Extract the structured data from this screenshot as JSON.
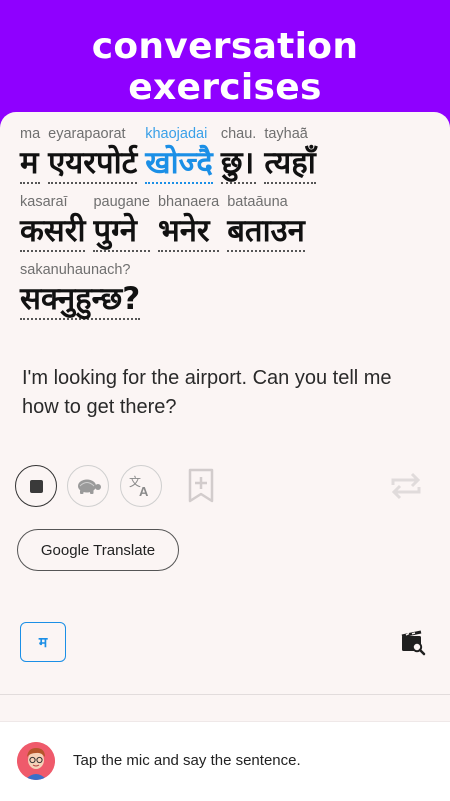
{
  "banner": {
    "title": "conversation exercises"
  },
  "sentence": {
    "lines": [
      [
        {
          "translit": "ma",
          "nepali": "म",
          "highlight": false
        },
        {
          "translit": "eyarapaorat",
          "nepali": "एयरपोर्ट",
          "highlight": false
        },
        {
          "translit": "khaojadai",
          "nepali": "खोज्दै",
          "highlight": true
        },
        {
          "translit": "chau.",
          "nepali": "छु।",
          "highlight": false
        },
        {
          "translit": "tayhaā̃",
          "nepali": "त्यहाँ",
          "highlight": false
        }
      ],
      [
        {
          "translit": "kasaraī",
          "nepali": "कसरी",
          "highlight": false
        },
        {
          "translit": "paugane",
          "nepali": "पुग्ने",
          "highlight": false
        },
        {
          "translit": "bhanaera",
          "nepali": "भनेर",
          "highlight": false
        },
        {
          "translit": "bataāuna",
          "nepali": "बताउन",
          "highlight": false
        }
      ],
      [
        {
          "translit": "sakanuhaunach?",
          "nepali": "सक्नुहुन्छ?",
          "highlight": false
        }
      ]
    ]
  },
  "english": "I'm looking for the airport. Can you tell me how to get there?",
  "controls": {
    "icons": [
      "stop-icon",
      "turtle-icon",
      "translate-icon",
      "bookmark-add-icon",
      "repeat-icon"
    ]
  },
  "google_translate": {
    "label": "Google Translate"
  },
  "letter_button": {
    "label": "म"
  },
  "footer": {
    "prompt": "Tap the mic and say the sentence."
  },
  "colors": {
    "banner": "#8f00ff",
    "highlight": "#1b8fe6",
    "card": "#fbf5f4"
  }
}
